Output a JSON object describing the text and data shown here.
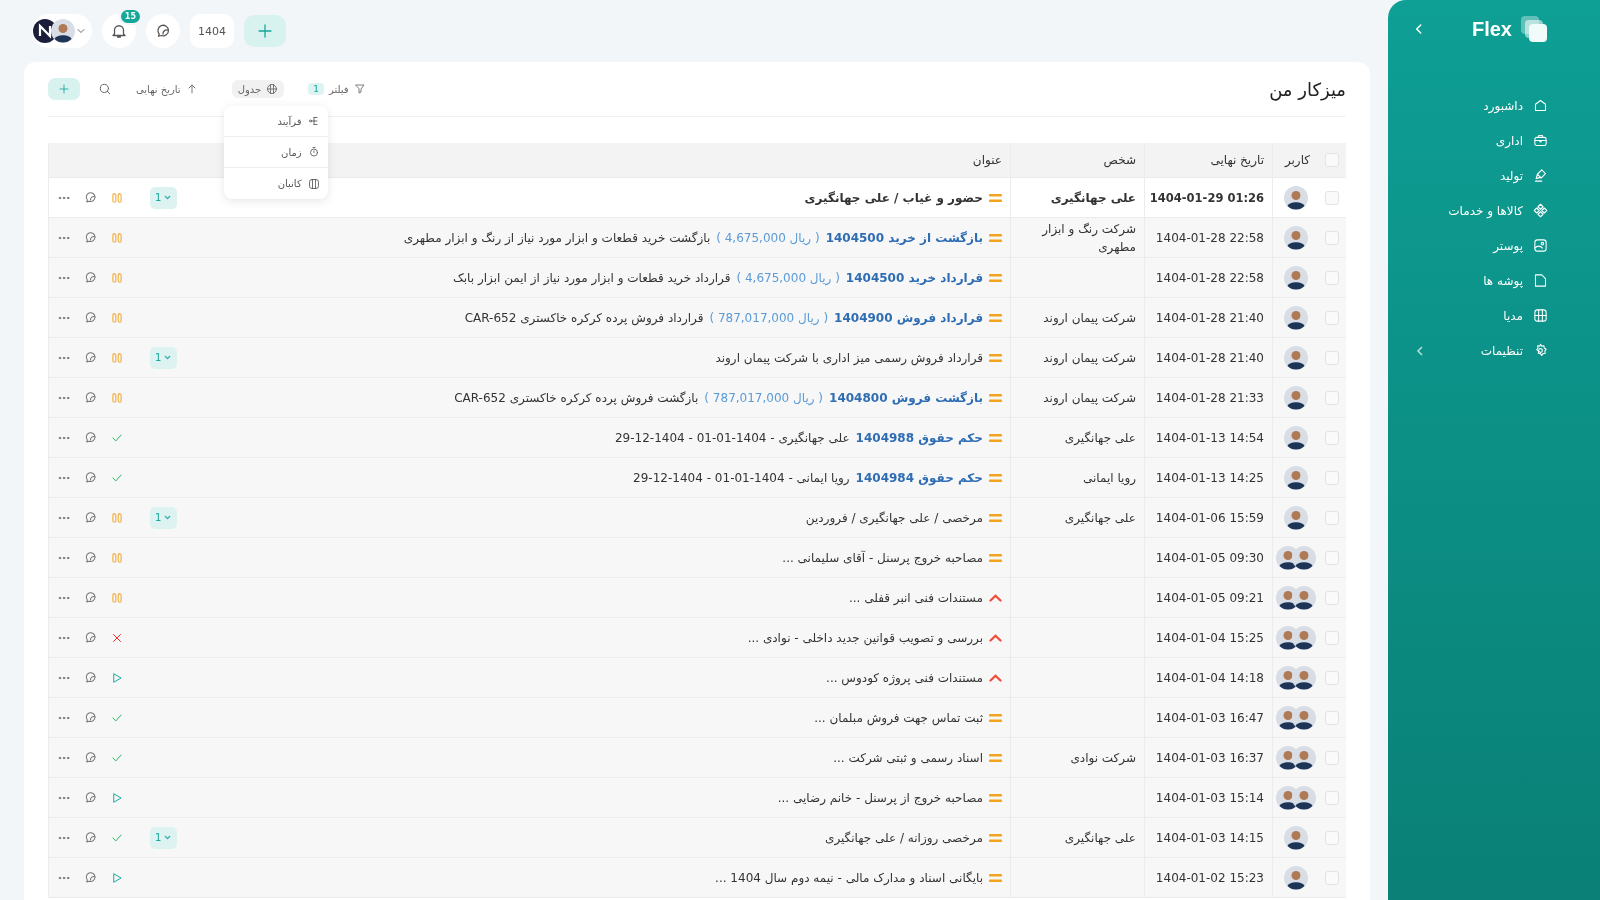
{
  "topbar": {
    "notifications": "15",
    "year": "1404"
  },
  "sidebar": {
    "logo": "Flex",
    "items": [
      {
        "label": "داشبورد",
        "expandable": false
      },
      {
        "label": "اداری",
        "expandable": false
      },
      {
        "label": "تولید",
        "expandable": false
      },
      {
        "label": "کالاها و خدمات",
        "expandable": false
      },
      {
        "label": "پوستر",
        "expandable": false
      },
      {
        "label": "پوشه ها",
        "expandable": false
      },
      {
        "label": "مدیا",
        "expandable": false
      },
      {
        "label": "تنظیمات",
        "expandable": true
      }
    ]
  },
  "page": {
    "title": "میزکار من",
    "toolbar": {
      "sort": "تاریخ نهایی",
      "view": "جدول",
      "filter": "فیلتر",
      "filter_count": "1"
    },
    "view_menu": [
      {
        "label": "فرآیند"
      },
      {
        "label": "زمان"
      },
      {
        "label": "کانبان"
      }
    ]
  },
  "table": {
    "all_checked": false,
    "columns": [
      "کاربر",
      "تاریخ نهایی",
      "شخص",
      "عنوان"
    ],
    "rows": [
      {
        "checked": false,
        "unread": true,
        "kind": "single",
        "date": "1404-01-29 01:26",
        "person": "علی جهانگیری",
        "priority": {
          "kind": "medium"
        },
        "text": "حضور و غیاب / علی جهانگیری",
        "status": {
          "kind": "paused"
        },
        "subtasks": "1"
      },
      {
        "checked": false,
        "unread": false,
        "kind": "single",
        "date": "1404-01-28 22:58",
        "person": "شرکت رنگ و ابزار مطهری",
        "priority": {
          "kind": "medium"
        },
        "link": "بازگشت از خرید 1404500",
        "amount": "( 4,675,000 ریال )",
        "text": "بازگشت خرید قطعات و ابزار مورد نیاز از رنگ و ابزار مطهری",
        "status": {
          "kind": "paused"
        }
      },
      {
        "checked": false,
        "unread": false,
        "kind": "single",
        "date": "1404-01-28 22:58",
        "priority": {
          "kind": "medium"
        },
        "link": "قرارداد خرید 1404500",
        "amount": "( 4,675,000 ریال )",
        "text": "قرارداد خرید قطعات و ابزار مورد نیاز از ایمن ابزار بابک",
        "status": {
          "kind": "paused"
        }
      },
      {
        "checked": false,
        "unread": false,
        "kind": "single",
        "date": "1404-01-28 21:40",
        "person": "شرکت پیمان اروند",
        "priority": {
          "kind": "medium"
        },
        "link": "قرارداد فروش 1404900",
        "amount": "( 787,017,000 ریال )",
        "text": "قرارداد فروش پرده کرکره خاکستری CAR-652",
        "status": {
          "kind": "paused"
        }
      },
      {
        "checked": false,
        "unread": false,
        "kind": "single",
        "date": "1404-01-28 21:40",
        "person": "شرکت پیمان اروند",
        "priority": {
          "kind": "medium"
        },
        "text": "قرارداد فروش رسمی میز اداری با شرکت پیمان اروند",
        "status": {
          "kind": "paused"
        },
        "subtasks": "1"
      },
      {
        "checked": false,
        "unread": false,
        "kind": "single",
        "date": "1404-01-28 21:33",
        "person": "شرکت پیمان اروند",
        "priority": {
          "kind": "medium"
        },
        "link": "بازگشت فروش 1404800",
        "amount": "( 787,017,000 ریال )",
        "text": "بازگشت فروش پرده کرکره خاکستری CAR-652",
        "status": {
          "kind": "paused"
        }
      },
      {
        "checked": false,
        "unread": false,
        "kind": "single",
        "date": "1404-01-13 14:54",
        "person": "علی جهانگیری",
        "priority": {
          "kind": "medium"
        },
        "link": "حکم حقوق 1404988",
        "text": "علی جهانگیری - 1404-01-01 - 1404-12-29",
        "status": {
          "kind": "done"
        }
      },
      {
        "checked": false,
        "unread": false,
        "kind": "single",
        "date": "1404-01-13 14:25",
        "person": "رویا ایمانی",
        "priority": {
          "kind": "medium"
        },
        "link": "حکم حقوق 1404984",
        "text": "رویا ایمانی - 1404-01-01 - 1404-12-29",
        "status": {
          "kind": "done"
        }
      },
      {
        "checked": false,
        "unread": false,
        "kind": "single",
        "date": "1404-01-06 15:59",
        "person": "علی جهانگیری",
        "priority": {
          "kind": "medium"
        },
        "text": "مرخصی / علی جهانگیری / فروردین",
        "status": {
          "kind": "paused"
        },
        "subtasks": "1"
      },
      {
        "checked": false,
        "unread": false,
        "kind": "pair",
        "date": "1404-01-05 09:30",
        "priority": {
          "kind": "medium"
        },
        "text": "مصاحبه خروج پرسنل - آقای سلیمانی ...",
        "status": {
          "kind": "paused"
        }
      },
      {
        "checked": false,
        "unread": false,
        "kind": "pair",
        "date": "1404-01-05 09:21",
        "priority": {
          "kind": "high"
        },
        "text": "مستندات فنی انبر قفلی ...",
        "status": {
          "kind": "paused"
        }
      },
      {
        "checked": false,
        "unread": false,
        "kind": "pair",
        "date": "1404-01-04 15:25",
        "priority": {
          "kind": "high"
        },
        "text": "بررسی و تصویب قوانین جدید داخلی - نوادی ...",
        "status": {
          "kind": "rejected"
        }
      },
      {
        "checked": false,
        "unread": false,
        "kind": "pair",
        "date": "1404-01-04 14:18",
        "priority": {
          "kind": "high"
        },
        "text": "مستندات فنی پروژه کودوس ...",
        "status": {
          "kind": "running"
        }
      },
      {
        "checked": false,
        "unread": false,
        "kind": "pair",
        "date": "1404-01-03 16:47",
        "priority": {
          "kind": "medium"
        },
        "text": "ثبت تماس جهت فروش مبلمان ...",
        "status": {
          "kind": "done"
        }
      },
      {
        "checked": false,
        "unread": false,
        "kind": "pair",
        "date": "1404-01-03 16:37",
        "person": "شرکت نوادی",
        "priority": {
          "kind": "medium"
        },
        "text": "اسناد رسمی و ثبتی شرکت ...",
        "status": {
          "kind": "done"
        }
      },
      {
        "checked": false,
        "unread": false,
        "kind": "pair",
        "date": "1404-01-03 15:14",
        "priority": {
          "kind": "medium"
        },
        "text": "مصاحبه خروج از پرسنل - خانم رضایی ...",
        "status": {
          "kind": "running"
        }
      },
      {
        "checked": false,
        "unread": false,
        "kind": "single",
        "date": "1404-01-03 14:15",
        "person": "علی جهانگیری",
        "priority": {
          "kind": "medium"
        },
        "text": "مرخصی روزانه / علی جهانگیری",
        "status": {
          "kind": "done"
        },
        "subtasks": "1"
      },
      {
        "checked": false,
        "unread": false,
        "kind": "single",
        "date": "1404-01-02 15:23",
        "priority": {
          "kind": "medium"
        },
        "text": "بایگانی اسناد و مدارک مالی - نیمه دوم سال 1404 ...",
        "status": {
          "kind": "running"
        }
      }
    ]
  }
}
